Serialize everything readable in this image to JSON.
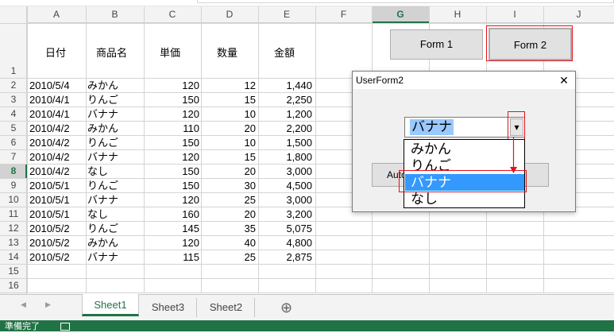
{
  "columns": [
    "A",
    "B",
    "C",
    "D",
    "E",
    "F",
    "G",
    "H",
    "I",
    "J"
  ],
  "selected_column": "G",
  "rows": [
    "1",
    "2",
    "3",
    "4",
    "5",
    "6",
    "7",
    "8",
    "9",
    "10",
    "11",
    "12",
    "13",
    "14",
    "15",
    "16"
  ],
  "selected_row": "8",
  "header_row": {
    "date": "日付",
    "product": "商品名",
    "price": "単価",
    "qty": "数量",
    "amount": "金額"
  },
  "data_rows": [
    {
      "date": "2010/5/4",
      "product": "みかん",
      "price": "120",
      "qty": "12",
      "amount": "1,440"
    },
    {
      "date": "2010/4/1",
      "product": "りんご",
      "price": "150",
      "qty": "15",
      "amount": "2,250"
    },
    {
      "date": "2010/4/1",
      "product": "バナナ",
      "price": "120",
      "qty": "10",
      "amount": "1,200"
    },
    {
      "date": "2010/4/2",
      "product": "みかん",
      "price": "110",
      "qty": "20",
      "amount": "2,200"
    },
    {
      "date": "2010/4/2",
      "product": "りんご",
      "price": "150",
      "qty": "10",
      "amount": "1,500"
    },
    {
      "date": "2010/4/2",
      "product": "バナナ",
      "price": "120",
      "qty": "15",
      "amount": "1,800"
    },
    {
      "date": "2010/4/2",
      "product": "なし",
      "price": "150",
      "qty": "20",
      "amount": "3,000"
    },
    {
      "date": "2010/5/1",
      "product": "りんご",
      "price": "150",
      "qty": "30",
      "amount": "4,500"
    },
    {
      "date": "2010/5/1",
      "product": "バナナ",
      "price": "120",
      "qty": "25",
      "amount": "3,000"
    },
    {
      "date": "2010/5/1",
      "product": "なし",
      "price": "160",
      "qty": "20",
      "amount": "3,200"
    },
    {
      "date": "2010/5/2",
      "product": "りんご",
      "price": "145",
      "qty": "35",
      "amount": "5,075"
    },
    {
      "date": "2010/5/2",
      "product": "みかん",
      "price": "120",
      "qty": "40",
      "amount": "4,800"
    },
    {
      "date": "2010/5/2",
      "product": "バナナ",
      "price": "115",
      "qty": "25",
      "amount": "2,875"
    }
  ],
  "buttons": {
    "form1": "Form 1",
    "form2": "Form 2"
  },
  "userform": {
    "title": "UserForm2",
    "close_glyph": "✕",
    "combo_value": "バナナ",
    "dropdown_arrow": "▾",
    "hidden_button_label": "Auto",
    "options": [
      "みかん",
      "りんご",
      "バナナ",
      "なし"
    ],
    "highlighted_option": "バナナ"
  },
  "sheet_tabs": [
    "Sheet1",
    "Sheet3",
    "Sheet2"
  ],
  "active_tab": "Sheet1",
  "nav_left": "◀",
  "nav_right": "▶",
  "add_sheet": "⊕",
  "status": {
    "text": "準備完了"
  },
  "colors": {
    "excel_green": "#217346",
    "red": "#e0151b",
    "highlight": "#3399ff"
  }
}
